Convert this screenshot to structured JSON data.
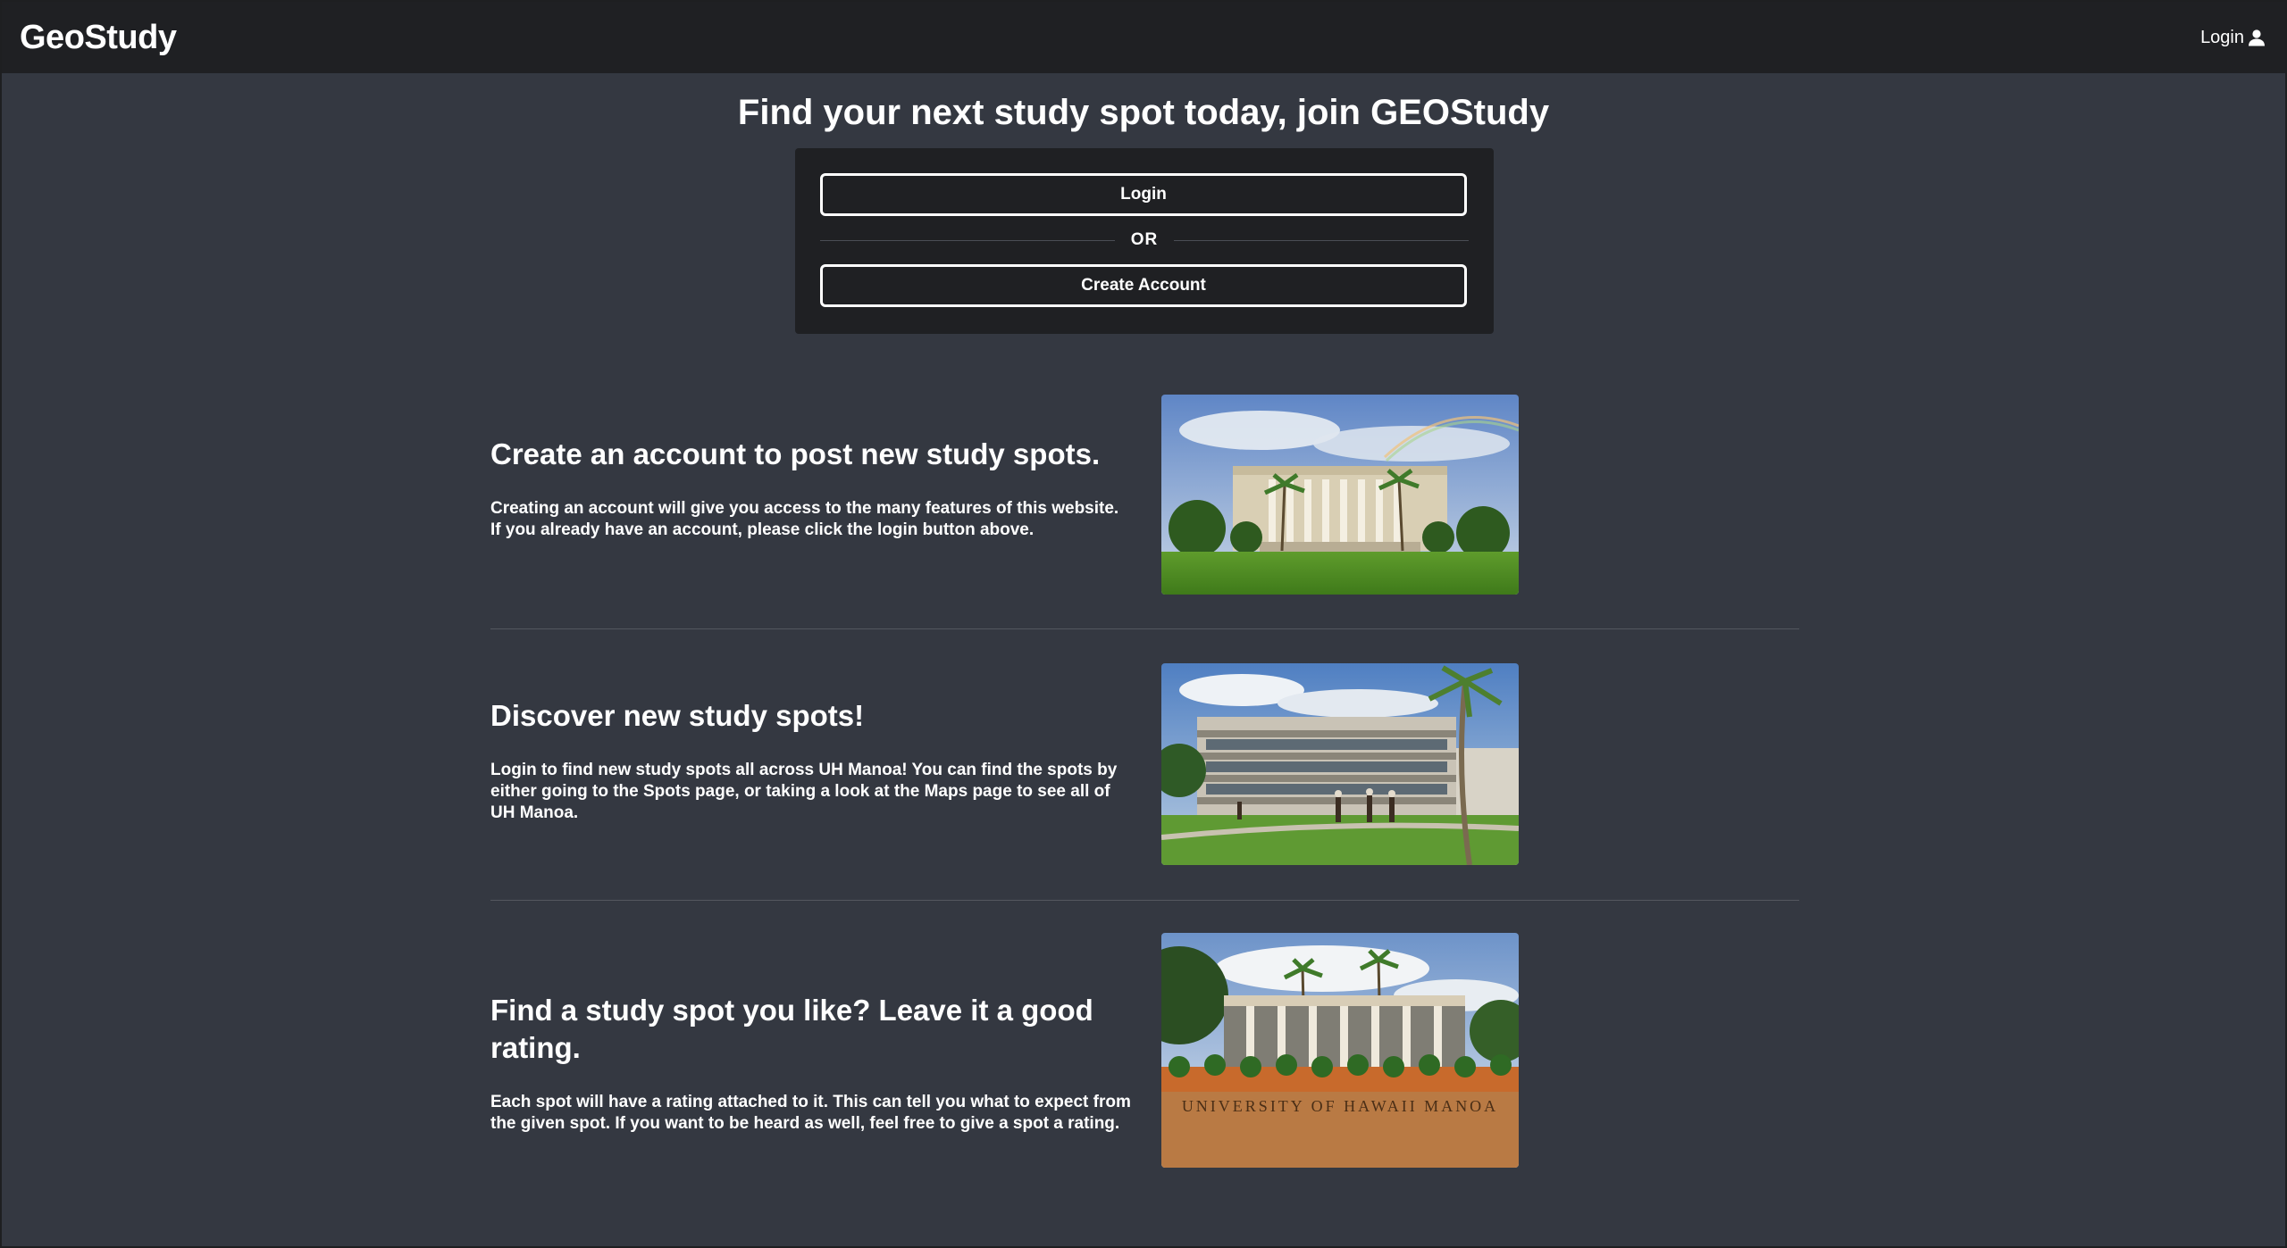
{
  "navbar": {
    "brand": "GeoStudy",
    "login_label": "Login"
  },
  "hero": {
    "headline": "Find your next study spot today, join GEOStudy"
  },
  "auth_card": {
    "login_button": "Login",
    "or_text": "OR",
    "create_account_button": "Create Account"
  },
  "features": [
    {
      "title": "Create an account to post new study spots.",
      "description": "Creating an account will give you access to the many features of this website. If you already have an account, please click the login button above.",
      "image_subject": "campus-building-with-rainbow"
    },
    {
      "title": "Discover new study spots!",
      "description": "Login to find new study spots all across UH Manoa! You can find the spots by either going to the Spots page, or taking a look at the Maps page to see all of UH Manoa.",
      "image_subject": "campus-library-with-students"
    },
    {
      "title": "Find a study spot you like? Leave it a good rating.",
      "description": "Each spot will have a rating attached to it. This can tell you what to expect from the given spot. If you want to be heard as well, feel free to give a spot a rating.",
      "image_subject": "university-entrance-sign",
      "image_sign_text": "UNIVERSITY OF HAWAII MANOA"
    }
  ],
  "colors": {
    "page_background": "#343841",
    "navbar_background": "#1f2023",
    "card_background": "#1f2023",
    "text": "#ffffff",
    "divider": "#54575f"
  }
}
